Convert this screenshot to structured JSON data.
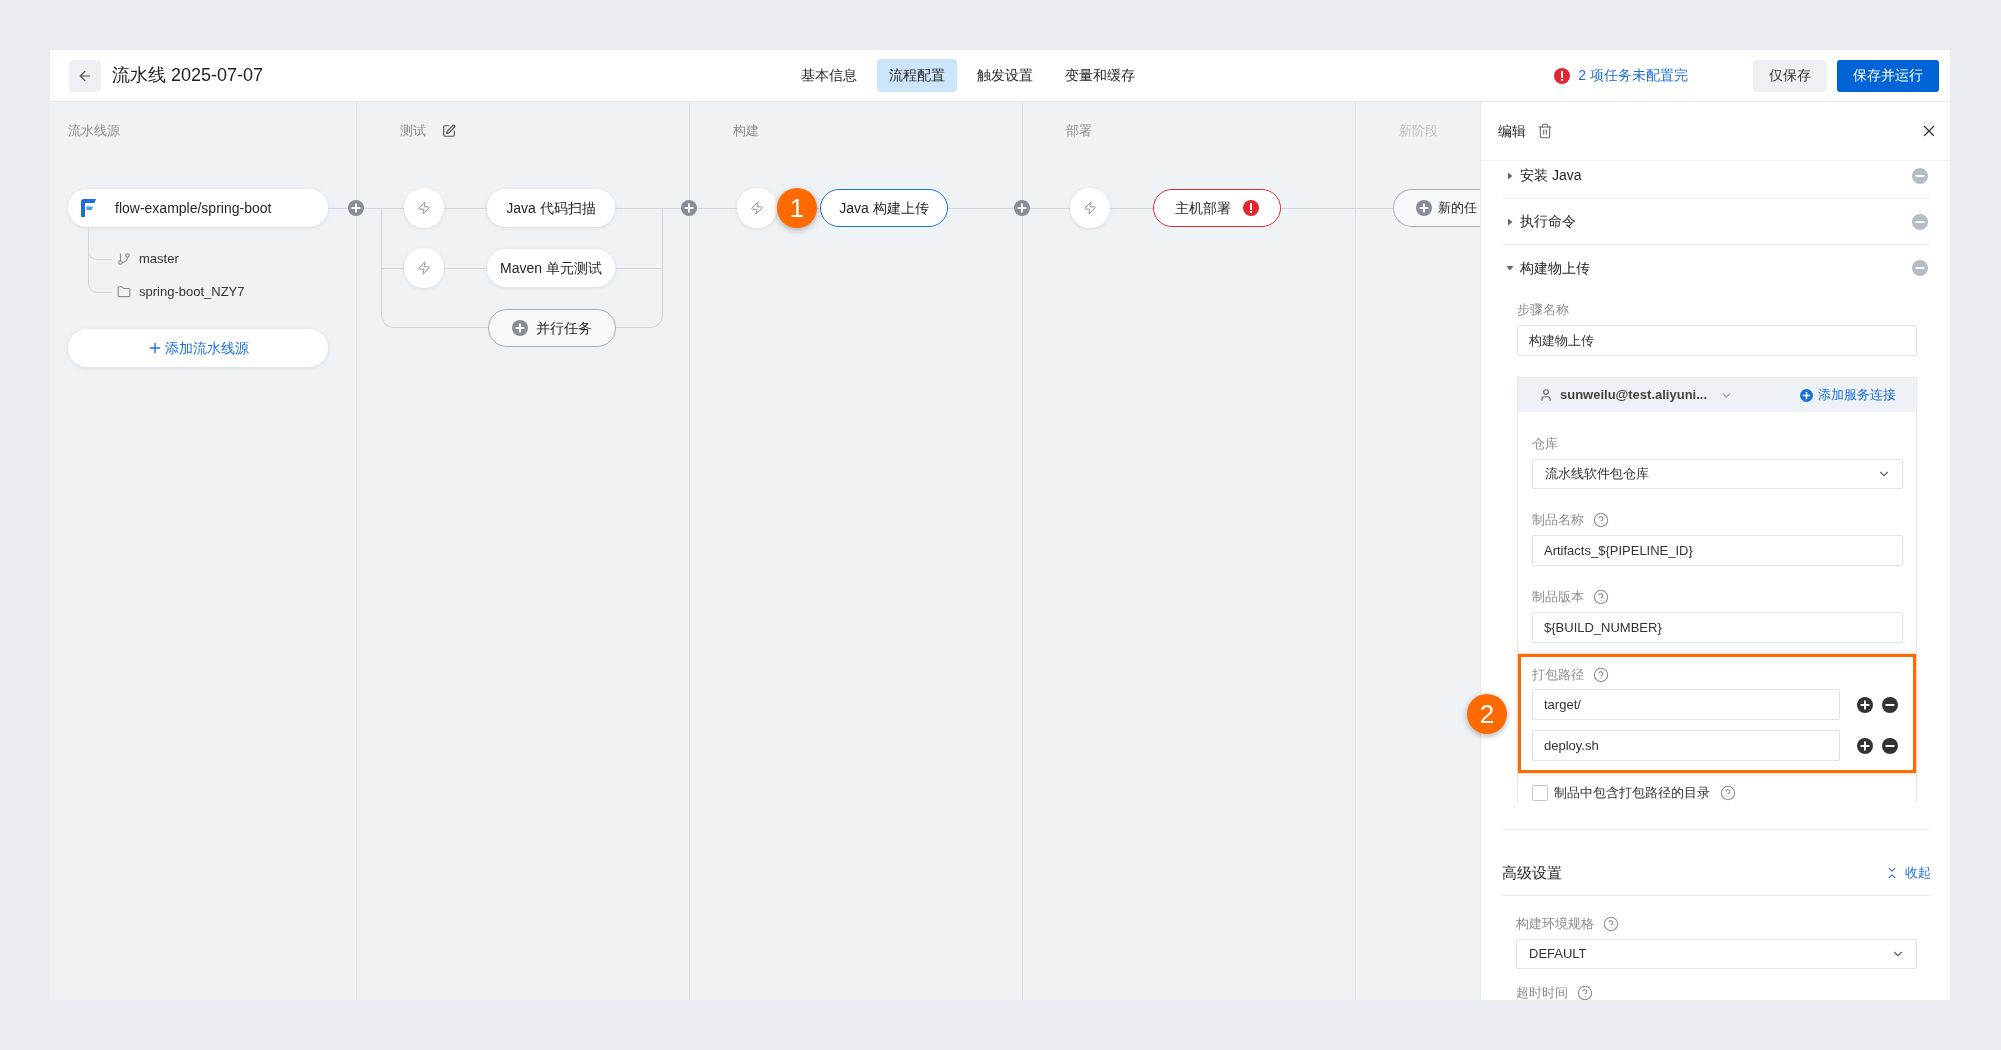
{
  "header": {
    "title": "流水线 2025-07-07",
    "tabs": [
      {
        "label": "基本信息",
        "selected": false
      },
      {
        "label": "流程配置",
        "selected": true
      },
      {
        "label": "触发设置",
        "selected": false
      },
      {
        "label": "变量和缓存",
        "selected": false
      }
    ],
    "warning": "2 项任务未配置完",
    "buttons": [
      {
        "label": "仅保存",
        "kind": "secondary"
      },
      {
        "label": "保存并运行",
        "kind": "primary"
      }
    ]
  },
  "stages": [
    {
      "kind": "source",
      "title": "流水线源",
      "edit_icon": false,
      "source": {
        "name": "flow-example/spring-boot",
        "children": [
          {
            "kind": "branch",
            "label": "master"
          },
          {
            "kind": "folder",
            "label": "spring-boot_NZY7"
          }
        ]
      },
      "add_button": "添加流水线源"
    },
    {
      "kind": "tasks",
      "title": "测试",
      "edit_icon": true,
      "tasks": [
        {
          "name": "Java 代码扫描",
          "selected": false,
          "error": false
        },
        {
          "name": "Maven 单元测试",
          "selected": false,
          "error": false
        }
      ],
      "add_parallel": "并行任务"
    },
    {
      "kind": "tasks",
      "title": "构建",
      "edit_icon": false,
      "tasks": [
        {
          "name": "Java 构建上传",
          "selected": true,
          "error": false,
          "callout": "1"
        }
      ]
    },
    {
      "kind": "tasks",
      "title": "部署",
      "edit_icon": false,
      "tasks": [
        {
          "name": "主机部署",
          "selected": false,
          "error": true
        }
      ]
    },
    {
      "kind": "new",
      "title": "新阶段",
      "edit_icon": false,
      "new_task": "新的任"
    }
  ],
  "editor": {
    "title": "编辑",
    "steps": [
      {
        "name": "安装 Java",
        "expanded": false
      },
      {
        "name": "执行命令",
        "expanded": false
      },
      {
        "name": "构建物上传",
        "expanded": true,
        "form": {
          "name_field": {
            "label": "步骤名称",
            "value": "构建物上传"
          },
          "connection": {
            "account": "sunweilu@test.aliyuni...",
            "add_link": "添加服务连接"
          },
          "fields": [
            {
              "kind": "select",
              "label": "仓库",
              "help": false,
              "value": "流水线软件包仓库"
            },
            {
              "kind": "input",
              "label": "制品名称",
              "help": true,
              "value": "Artifacts_${PIPELINE_ID}"
            },
            {
              "kind": "input",
              "label": "制品版本",
              "help": true,
              "value": "${BUILD_NUMBER}"
            },
            {
              "kind": "paths",
              "label": "打包路径",
              "help": true,
              "highlighted": true,
              "callout": "2",
              "values": [
                "target/",
                "deploy.sh"
              ]
            },
            {
              "kind": "checkbox",
              "label": "制品中包含打包路径的目录",
              "help": true,
              "checked": false
            }
          ]
        }
      }
    ],
    "advanced": {
      "title": "高级设置",
      "toggle": "收起",
      "fields": [
        {
          "kind": "select",
          "label": "构建环境规格",
          "help": true,
          "value": "DEFAULT"
        },
        {
          "kind": "label",
          "label": "超时时间",
          "help": true
        }
      ]
    }
  }
}
